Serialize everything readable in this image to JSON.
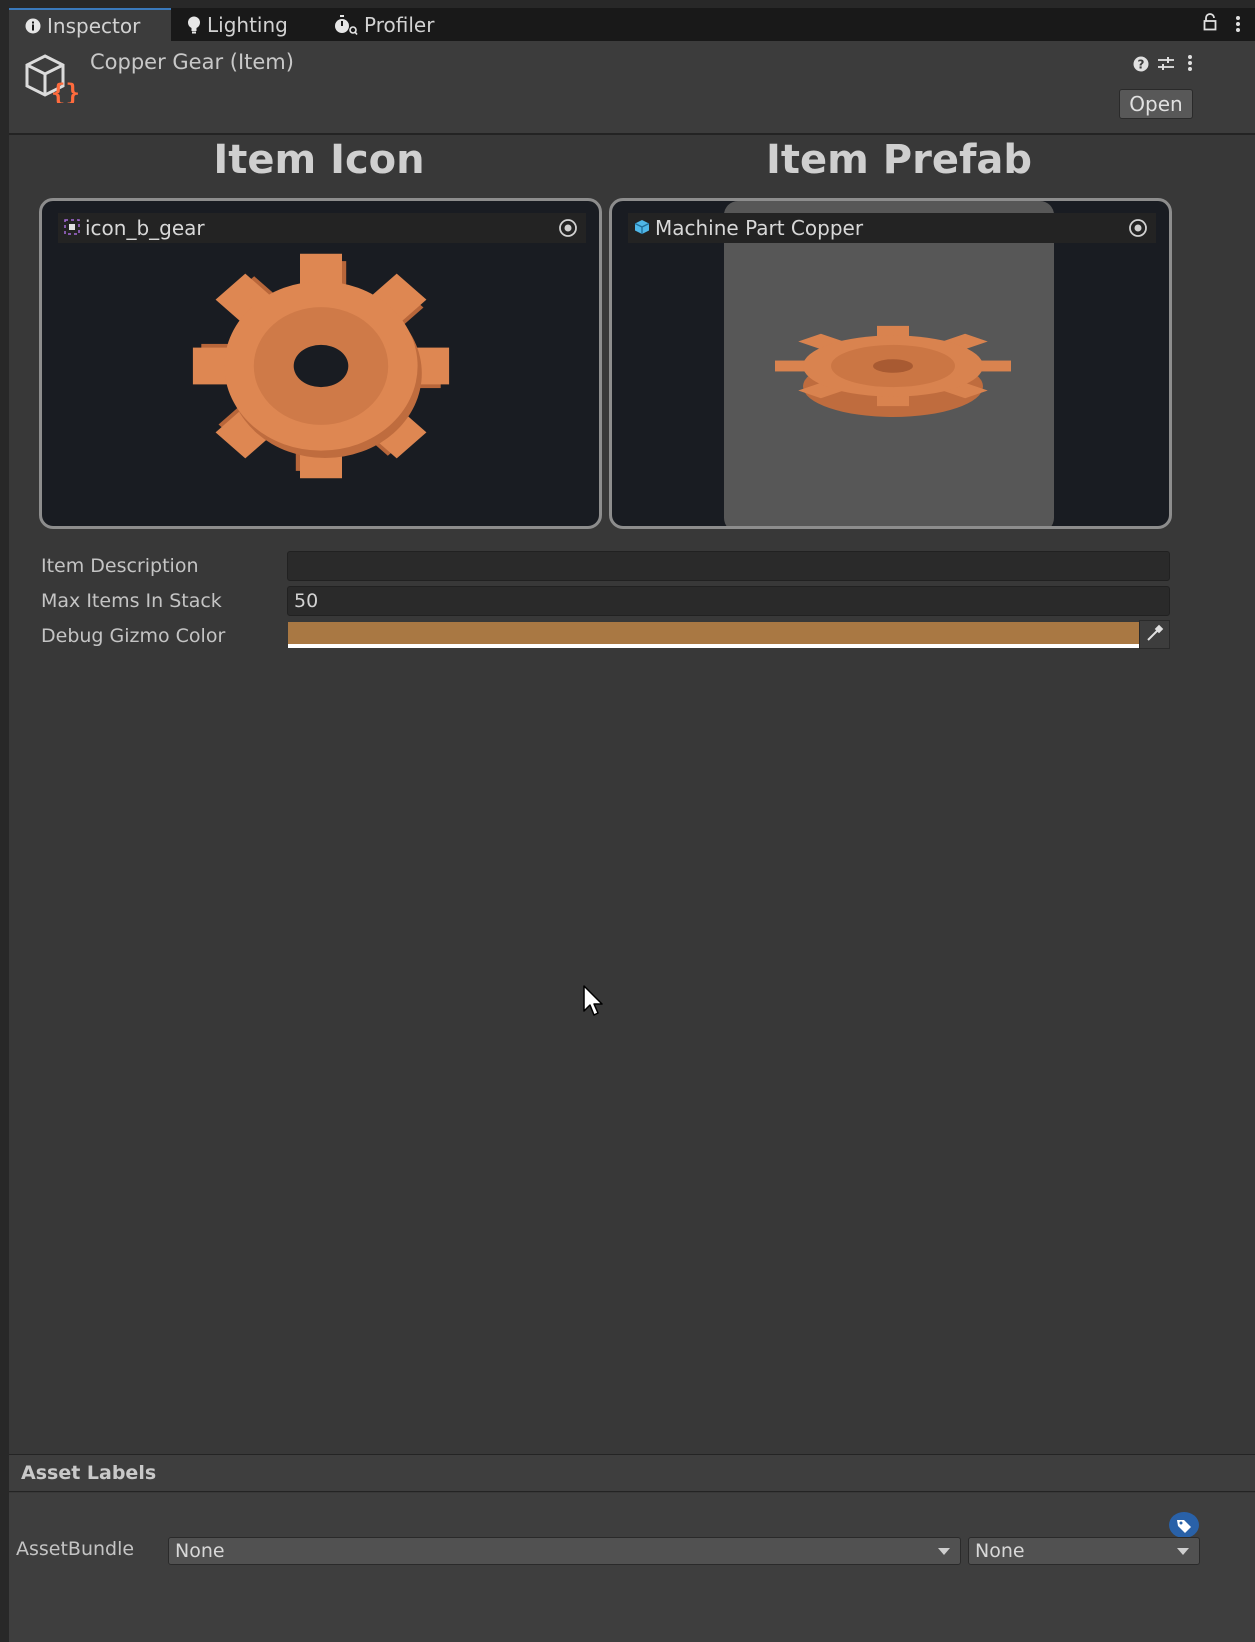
{
  "tabs": [
    {
      "label": "Inspector",
      "icon": "info-icon",
      "active": true
    },
    {
      "label": "Lighting",
      "icon": "lightbulb-icon",
      "active": false
    },
    {
      "label": "Profiler",
      "icon": "profiler-stopwatch-icon",
      "active": false
    }
  ],
  "header": {
    "title": "Copper Gear (Item)",
    "asset_icon": "scriptable-object-icon",
    "open_label": "Open"
  },
  "sections": {
    "icon_heading": "Item Icon",
    "prefab_heading": "Item Prefab"
  },
  "icon_field": {
    "value": "icon_b_gear",
    "icon": "sprite-icon"
  },
  "prefab_field": {
    "value": "Machine Part Copper",
    "icon": "prefab-cube-icon"
  },
  "properties": {
    "description_label": "Item Description",
    "description_value": "",
    "max_stack_label": "Max Items In Stack",
    "max_stack_value": "50",
    "gizmo_color_label": "Debug Gizmo Color",
    "gizmo_color": "#a97843"
  },
  "footer": {
    "asset_labels_title": "Asset Labels",
    "asset_bundle_label": "AssetBundle",
    "asset_bundle_value": "None",
    "asset_bundle_variant_value": "None"
  },
  "colors": {
    "accent": "#3a79bb",
    "gear": "#d9834f"
  }
}
